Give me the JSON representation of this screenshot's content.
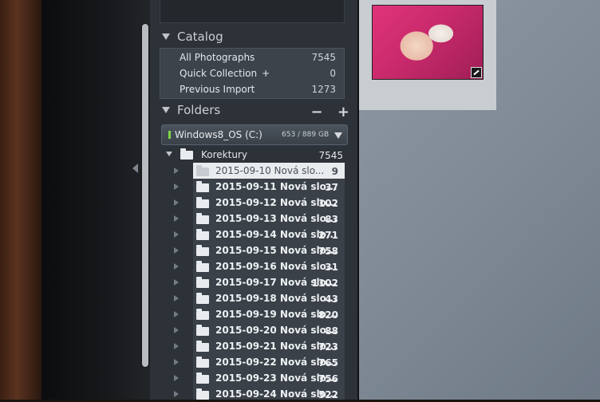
{
  "catalog": {
    "title": "Catalog",
    "items": [
      {
        "label": "All Photographs",
        "count": "7545"
      },
      {
        "label": "Quick Collection",
        "plus": "+",
        "count": "0"
      },
      {
        "label": "Previous Import",
        "count": "1273"
      }
    ]
  },
  "folders": {
    "title": "Folders",
    "remove": "−",
    "add": "+",
    "volume": {
      "name": "Windows8_OS (C:)",
      "size": "653 / 889 GB"
    },
    "root": {
      "name": "Korektury",
      "count": "7545"
    },
    "subfolders": [
      {
        "name": "2015-09-10 Nová slo...",
        "count": "9"
      },
      {
        "name": "2015-09-11 Nová slo...",
        "count": "37"
      },
      {
        "name": "2015-09-12 Nová slo...",
        "count": "102"
      },
      {
        "name": "2015-09-13 Nová slo...",
        "count": "83"
      },
      {
        "name": "2015-09-14 Nová slo...",
        "count": "271"
      },
      {
        "name": "2015-09-15 Nová slo...",
        "count": "758"
      },
      {
        "name": "2015-09-16 Nová slo...",
        "count": "31"
      },
      {
        "name": "2015-09-17 Nová slo...",
        "count": "1102"
      },
      {
        "name": "2015-09-18 Nová slo...",
        "count": "43"
      },
      {
        "name": "2015-09-19 Nová slo...",
        "count": "820"
      },
      {
        "name": "2015-09-20 Nová slo...",
        "count": "88"
      },
      {
        "name": "2015-09-21 Nová slo...",
        "count": "723"
      },
      {
        "name": "2015-09-22 Nová slo...",
        "count": "765"
      },
      {
        "name": "2015-09-23 Nová slo...",
        "count": "756"
      },
      {
        "name": "2015-09-24 Nová slo...",
        "count": "522"
      }
    ]
  },
  "icons": {
    "section_toggle": "triangle-down-icon",
    "folder": "folder-icon",
    "panel_collapse": "triangle-left-icon",
    "thumbnail_badge": "edited-badge-icon"
  },
  "colors": {
    "panel_bg": "#2d3238",
    "selected_row": "#e9ecef",
    "volume_led": "#7fd44b",
    "grid_bg": "#7f8a96"
  }
}
